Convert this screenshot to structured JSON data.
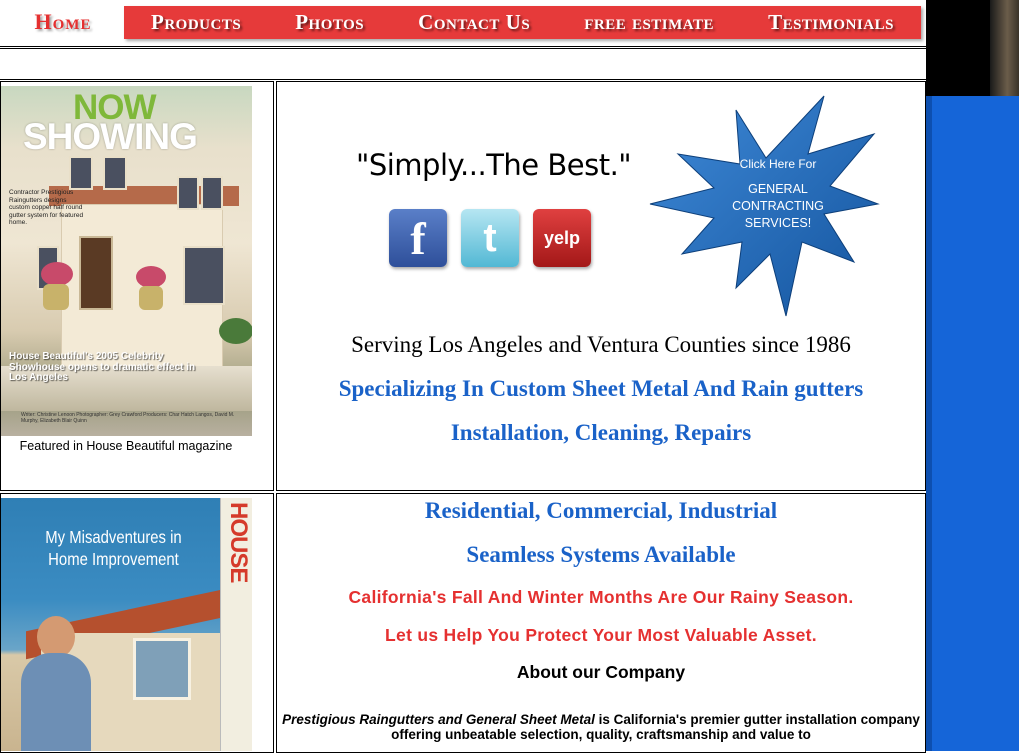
{
  "nav": {
    "home": "Home",
    "items": [
      "Products",
      "Photos",
      "Contact Us",
      "free estimate",
      "Testimonials"
    ]
  },
  "featured": {
    "cover_now": "NOW",
    "cover_showing": "SHOWING",
    "cover_note": "Contractor Prestigious Raingutters designs custom copper half round gutter system for featured home.",
    "cover_caption": "House Beautiful's 2005 Celebrity Showhouse opens to dramatic effect in Los Angeles",
    "cover_credits": "Writer: Christine Lenoon   Photographer: Grey Crawford   Producers: Char Hatch Langos, David M. Murphy, Elizabeth Blair Quinn",
    "label": "Featured in House Beautiful magazine"
  },
  "tagline": "\"Simply...The Best.\"",
  "social": {
    "facebook": "f",
    "twitter": "t",
    "yelp": "yelp"
  },
  "starburst": {
    "line1": "Click Here For",
    "line2": "GENERAL",
    "line3": "CONTRACTING",
    "line4": "SERVICES!"
  },
  "main": {
    "serving": "Serving Los Angeles and Ventura Counties since 1986",
    "specializing": "Specializing In Custom Sheet Metal And Rain gutters",
    "services": "Installation, Cleaning, Repairs",
    "sectors": "Residential, Commercial, Industrial",
    "seamless": "Seamless Systems Available",
    "rainy": "California's Fall And Winter Months Are Our Rainy Season.",
    "protect": "Let us Help You Protect Your Most Valuable Asset.",
    "about_heading": "About our Company",
    "about_company": "Prestigious Raingutters and General Sheet Metal",
    "about_text": " is California's premier gutter installation company offering unbeatable selection, quality, craftsmanship and value to"
  },
  "book": {
    "title": "My Misadventures in Home Improvement",
    "spine": "RICHARD KARN  HOUSE"
  },
  "colors": {
    "nav_red": "#e63a3a",
    "blue_text": "#1a62c8",
    "red_text": "#e53030",
    "side_blue": "#1565d8"
  }
}
